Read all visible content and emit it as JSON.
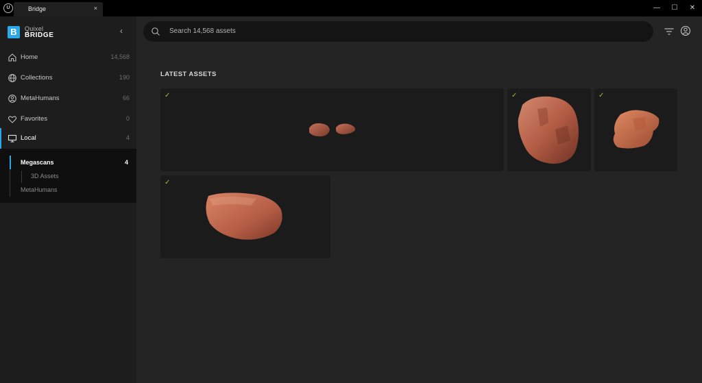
{
  "window": {
    "tab_title": "Bridge",
    "tab_close": "×",
    "engine_logo": "U",
    "controls": {
      "minimize": "—",
      "maximize": "☐",
      "close": "✕"
    }
  },
  "brand": {
    "mark": "B",
    "line1": "Quixel",
    "line2": "BRIDGE",
    "collapse": "‹"
  },
  "nav": [
    {
      "label": "Home",
      "count": "14,568",
      "icon": "home-icon"
    },
    {
      "label": "Collections",
      "count": "190",
      "icon": "globe-icon"
    },
    {
      "label": "MetaHumans",
      "count": "66",
      "icon": "person-circle-icon"
    },
    {
      "label": "Favorites",
      "count": "0",
      "icon": "heart-icon"
    },
    {
      "label": "Local",
      "count": "4",
      "icon": "monitor-icon"
    }
  ],
  "local_sub": {
    "megascans": {
      "label": "Megascans",
      "count": "4"
    },
    "assets3d": {
      "label": "3D Assets"
    },
    "metahumans": {
      "label": "MetaHumans"
    }
  },
  "search": {
    "placeholder": "Search 14,568 assets"
  },
  "main": {
    "section_title": "LATEST ASSETS",
    "check": "✓"
  },
  "colors": {
    "accent": "#2aa8e8",
    "check": "#9ac43a",
    "rock": "#b45d45"
  }
}
